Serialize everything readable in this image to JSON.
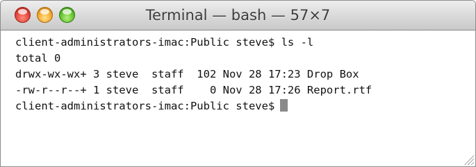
{
  "window": {
    "title": "Terminal — bash — 57×7"
  },
  "terminal": {
    "lines": [
      "client-administrators-imac:Public steve$ ls -l",
      "total 0",
      "drwx-wx-wx+ 3 steve  staff  102 Nov 28 17:23 Drop Box",
      "-rw-r--r--+ 1 steve  staff    0 Nov 28 17:26 Report.rtf"
    ],
    "prompt": "client-administrators-imac:Public steve$"
  },
  "icons": {
    "close": "close-button-icon",
    "minimize": "minimize-button-icon",
    "zoom": "zoom-button-icon",
    "resize": "resize-grip-icon"
  },
  "colors": {
    "close": "#e0443a",
    "minimize": "#f2a72a",
    "zoom": "#5fbf2a",
    "text": "#111111",
    "background": "#ffffff"
  }
}
